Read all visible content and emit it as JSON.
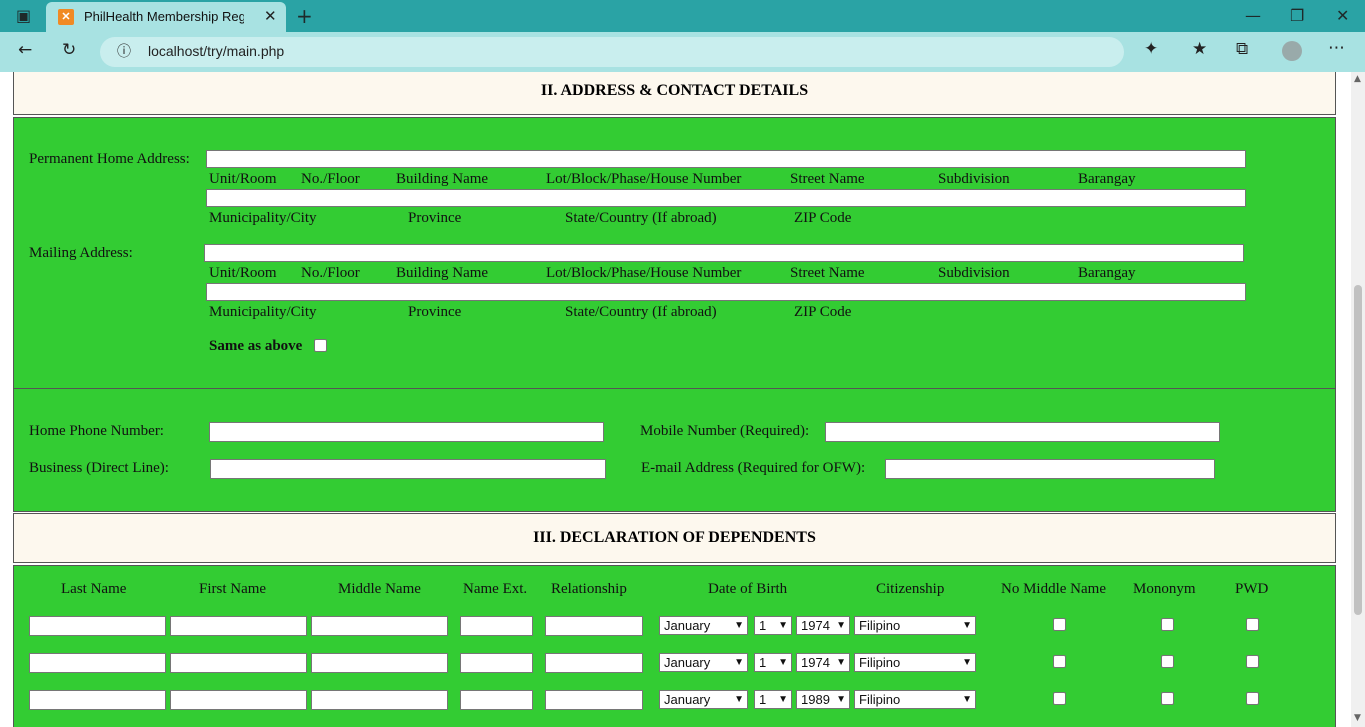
{
  "browser": {
    "tab_title": "PhilHealth Membership Registrat",
    "tab_close": "✕",
    "new_tab": "+",
    "url": "localhost/try/main.php",
    "favicon": "xampp-icon"
  },
  "section2": {
    "title": "II. ADDRESS & CONTACT DETAILS",
    "permanent_label": "Permanent Home Address:",
    "mailing_label": "Mailing Address:",
    "line1_labels": [
      "Unit/Room",
      "No./Floor",
      "Building Name",
      "Lot/Block/Phase/House Number",
      "Street Name",
      "Subdivision",
      "Barangay"
    ],
    "line2_labels": [
      "Municipality/City",
      "Province",
      "State/Country (If abroad)",
      "ZIP Code"
    ],
    "same_as_above": "Same as above",
    "home_phone": "Home Phone Number:",
    "mobile": "Mobile Number (Required):",
    "business": "Business (Direct Line):",
    "email": "E-mail Address (Required for OFW):"
  },
  "section3": {
    "title": "III. DECLARATION OF DEPENDENTS",
    "columns": [
      "Last Name",
      "First Name",
      "Middle Name",
      "Name Ext.",
      "Relationship",
      "Date of Birth",
      "Citizenship",
      "No Middle Name",
      "Mononym",
      "PWD"
    ],
    "rows": [
      {
        "month": "January",
        "day": "1",
        "year": "1974",
        "citizenship": "Filipino"
      },
      {
        "month": "January",
        "day": "1",
        "year": "1974",
        "citizenship": "Filipino"
      },
      {
        "month": "January",
        "day": "1",
        "year": "1989",
        "citizenship": "Filipino"
      }
    ]
  }
}
